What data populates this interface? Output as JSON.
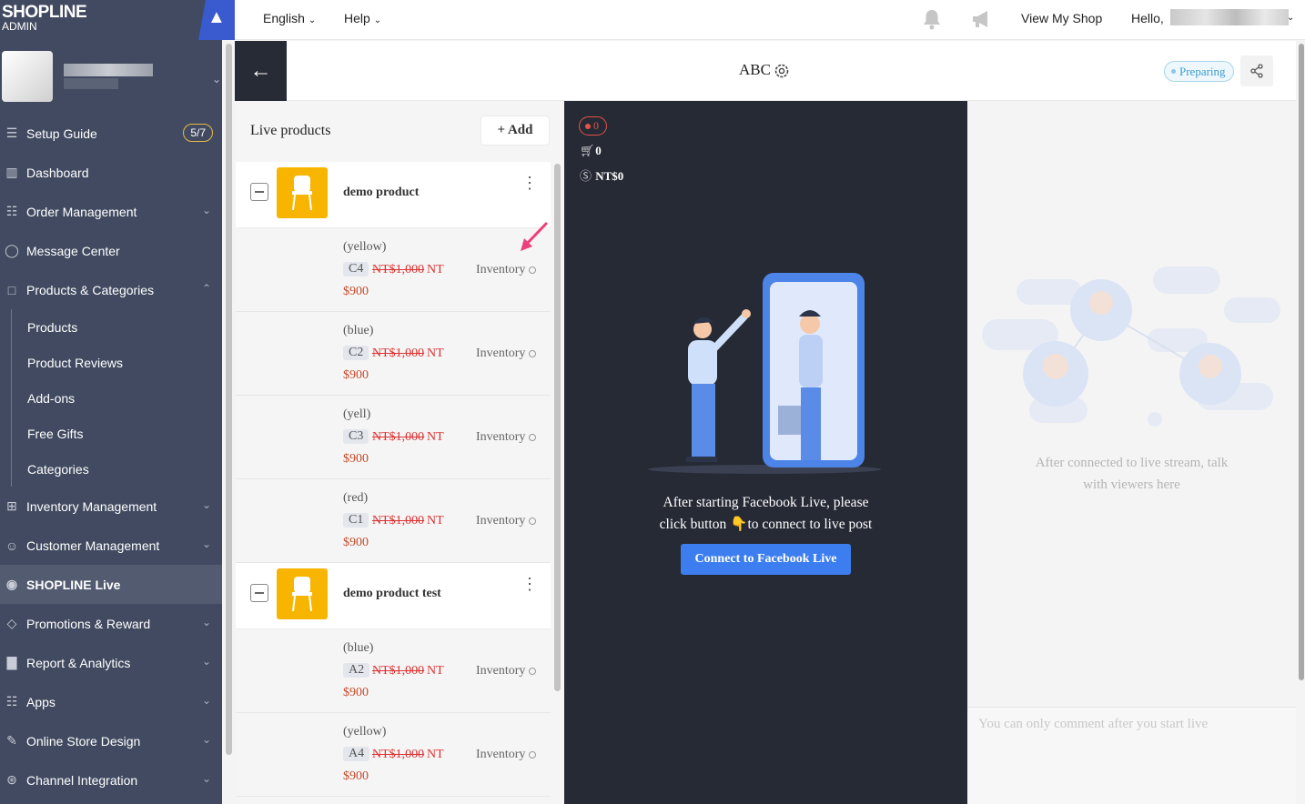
{
  "brand": {
    "name": "SHOPLINE",
    "sub": "ADMIN"
  },
  "topbar": {
    "language": "English",
    "help": "Help",
    "view_shop": "View My Shop",
    "hello": "Hello,"
  },
  "sidebar": {
    "items": [
      {
        "label": "Setup Guide",
        "icon": "signpost-icon",
        "badge": "5/7"
      },
      {
        "label": "Dashboard",
        "icon": "dashboard-icon"
      },
      {
        "label": "Order Management",
        "icon": "order-icon"
      },
      {
        "label": "Message Center",
        "icon": "chat-bubble-icon"
      },
      {
        "label": "Products & Categories",
        "icon": "bag-icon"
      },
      {
        "label": "Inventory Management",
        "icon": "boxes-icon"
      },
      {
        "label": "Customer Management",
        "icon": "person-icon"
      },
      {
        "label": "SHOPLINE Live",
        "icon": "broadcast-icon"
      },
      {
        "label": "Promotions & Reward",
        "icon": "tag-icon"
      },
      {
        "label": "Report & Analytics",
        "icon": "chart-icon"
      },
      {
        "label": "Apps",
        "icon": "apps-icon"
      },
      {
        "label": "Online Store Design",
        "icon": "brush-icon"
      },
      {
        "label": "Channel Integration",
        "icon": "channels-icon"
      }
    ],
    "subitems": [
      "Products",
      "Product Reviews",
      "Add-ons",
      "Free Gifts",
      "Categories"
    ]
  },
  "header": {
    "title": "ABC",
    "status": "Preparing"
  },
  "live_products": {
    "title": "Live products",
    "add_label": "+ Add",
    "products": [
      {
        "name": "demo product",
        "variants": [
          {
            "name": "(yellow)",
            "sku": "C4",
            "orig_price": "NT$1,000",
            "currency": "NT",
            "inventory": "Inventory",
            "sale": "$900"
          },
          {
            "name": "(blue)",
            "sku": "C2",
            "orig_price": "NT$1,000",
            "currency": "NT",
            "inventory": "Inventory",
            "sale": "$900"
          },
          {
            "name": "(yell)",
            "sku": "C3",
            "orig_price": "NT$1,000",
            "currency": "NT",
            "inventory": "Inventory",
            "sale": "$900"
          },
          {
            "name": "(red)",
            "sku": "C1",
            "orig_price": "NT$1,000",
            "currency": "NT",
            "inventory": "Inventory",
            "sale": "$900"
          }
        ]
      },
      {
        "name": "demo product test",
        "variants": [
          {
            "name": "(blue)",
            "sku": "A2",
            "orig_price": "NT$1,000",
            "currency": "NT",
            "inventory": "Inventory",
            "sale": "$900"
          },
          {
            "name": "(yellow)",
            "sku": "A4",
            "orig_price": "NT$1,000",
            "currency": "NT",
            "inventory": "Inventory",
            "sale": "$900"
          }
        ]
      }
    ]
  },
  "stage": {
    "viewers": "0",
    "cart_count": "0",
    "revenue": "NT$0",
    "message_line1": "After starting Facebook Live, please",
    "message_line2": "click button 👇to connect to live post",
    "connect_button": "Connect to Facebook Live"
  },
  "chat": {
    "message_line1": "After connected to live stream, talk",
    "message_line2": "with viewers here",
    "input_placeholder": "You can only comment after you start live"
  },
  "colors": {
    "sidebar": "#414a60",
    "accent": "#3c7ef0",
    "stage": "#262a35",
    "price": "#d33333"
  }
}
